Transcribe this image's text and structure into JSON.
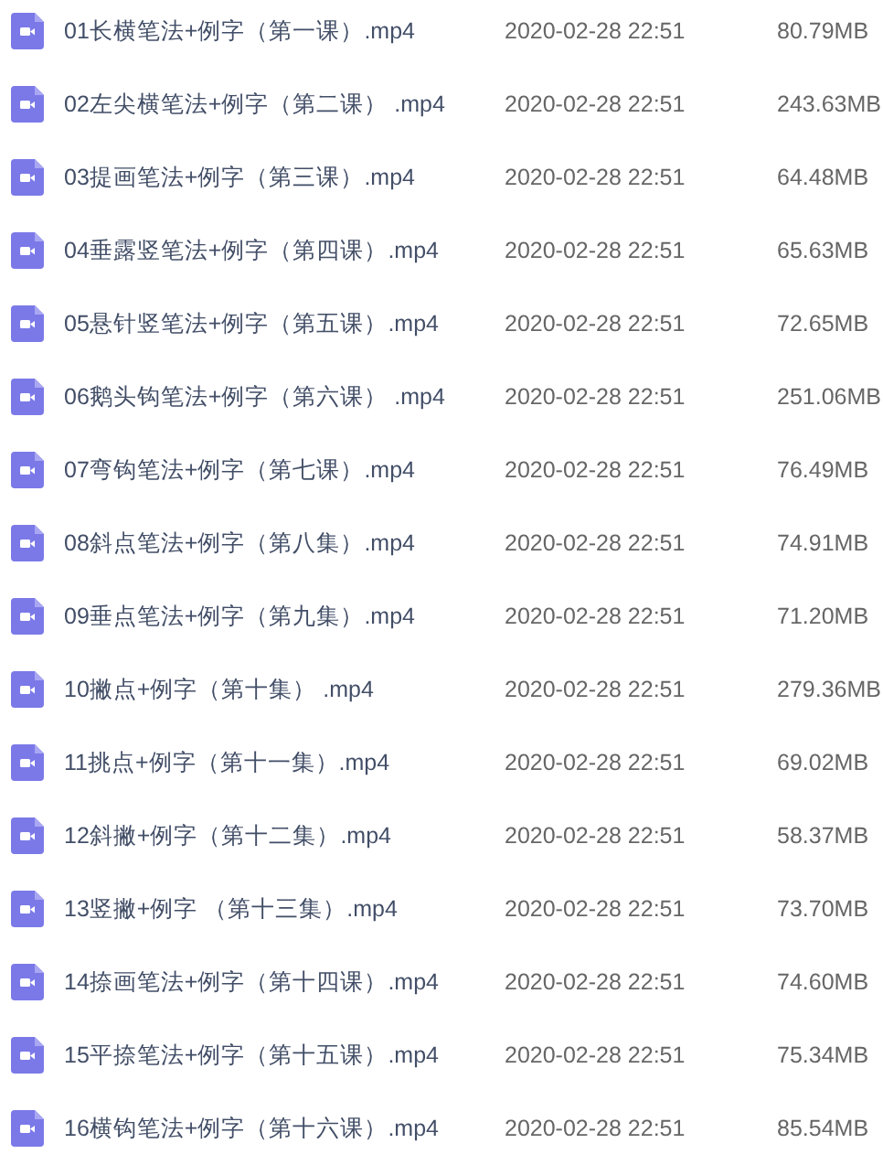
{
  "files": [
    {
      "name": "01长横笔法+例字（第一课）.mp4",
      "modified": "2020-02-28 22:51",
      "size": "80.79MB"
    },
    {
      "name": "02左尖横笔法+例字（第二课） .mp4",
      "modified": "2020-02-28 22:51",
      "size": "243.63MB"
    },
    {
      "name": "03提画笔法+例字（第三课）.mp4",
      "modified": "2020-02-28 22:51",
      "size": "64.48MB"
    },
    {
      "name": "04垂露竖笔法+例字（第四课）.mp4",
      "modified": "2020-02-28 22:51",
      "size": "65.63MB"
    },
    {
      "name": "05悬针竖笔法+例字（第五课）.mp4",
      "modified": "2020-02-28 22:51",
      "size": "72.65MB"
    },
    {
      "name": "06鹅头钩笔法+例字（第六课） .mp4",
      "modified": "2020-02-28 22:51",
      "size": "251.06MB"
    },
    {
      "name": "07弯钩笔法+例字（第七课）.mp4",
      "modified": "2020-02-28 22:51",
      "size": "76.49MB"
    },
    {
      "name": "08斜点笔法+例字（第八集）.mp4",
      "modified": "2020-02-28 22:51",
      "size": "74.91MB"
    },
    {
      "name": "09垂点笔法+例字（第九集）.mp4",
      "modified": "2020-02-28 22:51",
      "size": "71.20MB"
    },
    {
      "name": "10撇点+例字（第十集） .mp4",
      "modified": "2020-02-28 22:51",
      "size": "279.36MB"
    },
    {
      "name": "11挑点+例字（第十一集）.mp4",
      "modified": "2020-02-28 22:51",
      "size": "69.02MB"
    },
    {
      "name": "12斜撇+例字（第十二集）.mp4",
      "modified": "2020-02-28 22:51",
      "size": "58.37MB"
    },
    {
      "name": "13竖撇+例字 （第十三集）.mp4",
      "modified": "2020-02-28 22:51",
      "size": "73.70MB"
    },
    {
      "name": "14捺画笔法+例字（第十四课）.mp4",
      "modified": "2020-02-28 22:51",
      "size": "74.60MB"
    },
    {
      "name": "15平捺笔法+例字（第十五课）.mp4",
      "modified": "2020-02-28 22:51",
      "size": "75.34MB"
    },
    {
      "name": "16横钩笔法+例字（第十六课）.mp4",
      "modified": "2020-02-28 22:51",
      "size": "85.54MB"
    }
  ]
}
